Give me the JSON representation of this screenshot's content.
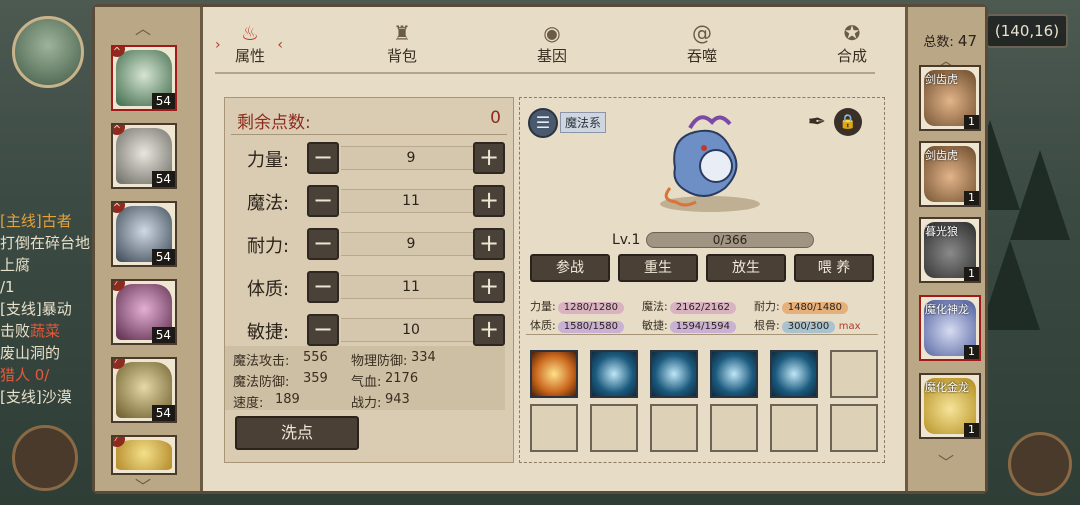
{
  "hud": {
    "coords": "(140,16)",
    "quests": [
      {
        "tag": "[主线]",
        "title": "古者",
        "body": "打倒在碎台地上腐",
        "sub": "/1"
      },
      {
        "tag": "[支线]",
        "title": "暴动",
        "body": "击败",
        "red": "蔬菜",
        "body2": "废山洞的",
        "sub": "猎人 0/"
      },
      {
        "tag": "[支线]",
        "title": "沙漠",
        "body": "",
        "sub": ""
      }
    ]
  },
  "tabs": [
    {
      "label": "属性",
      "icon": "fire-icon",
      "active": true
    },
    {
      "label": "背包",
      "icon": "bag-icon",
      "active": false
    },
    {
      "label": "基因",
      "icon": "eye-icon",
      "active": false
    },
    {
      "label": "吞噬",
      "icon": "swirl-icon",
      "active": false
    },
    {
      "label": "合成",
      "icon": "synth-icon",
      "active": false
    }
  ],
  "team": [
    {
      "level": "54",
      "colors": [
        "#d6e4d2",
        "#3d6a4a"
      ]
    },
    {
      "level": "54",
      "colors": [
        "#e9e6dd",
        "#6a6a64"
      ]
    },
    {
      "level": "54",
      "colors": [
        "#cfd9e4",
        "#3a4654"
      ]
    },
    {
      "level": "54",
      "colors": [
        "#e3b0d4",
        "#5a2a4a"
      ]
    },
    {
      "level": "54",
      "colors": [
        "#e6d9a6",
        "#6a5a2a"
      ]
    },
    {
      "level": "",
      "colors": [
        "#f3e08a",
        "#b48a2a"
      ]
    }
  ],
  "attributes": {
    "remaining_label": "剩余点数:",
    "remaining_value": "0",
    "stats": [
      {
        "name": "力量:",
        "value": "9"
      },
      {
        "name": "魔法:",
        "value": "11"
      },
      {
        "name": "耐力:",
        "value": "9"
      },
      {
        "name": "体质:",
        "value": "11"
      },
      {
        "name": "敏捷:",
        "value": "10"
      }
    ],
    "derived": [
      {
        "label": "魔法攻击:",
        "value": "556"
      },
      {
        "label": "物理防御:",
        "value": "334"
      },
      {
        "label": "魔法防御:",
        "value": "359"
      },
      {
        "label": "气血:",
        "value": "2176"
      },
      {
        "label": "速度:",
        "value": "189"
      },
      {
        "label": "战力:",
        "value": "943"
      }
    ],
    "wash_label": "洗点",
    "minus": "−",
    "plus": "+"
  },
  "pet": {
    "element": "魔法系",
    "level": "Lv.1",
    "exp": "0/366",
    "actions": [
      "参战",
      "重生",
      "放生",
      "喂 养"
    ],
    "caps": [
      {
        "label": "力量:",
        "value": "1280/1280",
        "color": "#d9b3c2"
      },
      {
        "label": "魔法:",
        "value": "2162/2162",
        "color": "#d9b3c2"
      },
      {
        "label": "耐力:",
        "value": "1480/1480",
        "color": "#e6b07a"
      },
      {
        "label": "体质:",
        "value": "1580/1580",
        "color": "#c9b0d4"
      },
      {
        "label": "敏捷:",
        "value": "1594/1594",
        "color": "#c9b0d4"
      },
      {
        "label": "根骨:",
        "value": "300/300",
        "color": "#a9c2cf"
      }
    ],
    "max_label": "max"
  },
  "inventory": {
    "total_label": "总数:",
    "total_value": "47",
    "items": [
      {
        "name": "剑齿虎",
        "qty": "1",
        "colors": [
          "#e2b48a",
          "#6a4a2a"
        ]
      },
      {
        "name": "剑齿虎",
        "qty": "1",
        "colors": [
          "#e2b48a",
          "#6a4a2a"
        ]
      },
      {
        "name": "暮光狼",
        "qty": "1",
        "colors": [
          "#8a8a8a",
          "#2a2a2a"
        ]
      },
      {
        "name": "魔化神龙",
        "qty": "1",
        "colors": [
          "#d6dcf2",
          "#4a5a9a"
        ]
      },
      {
        "name": "魔化金龙",
        "qty": "1",
        "colors": [
          "#f6e49a",
          "#b08a1a"
        ]
      }
    ]
  }
}
